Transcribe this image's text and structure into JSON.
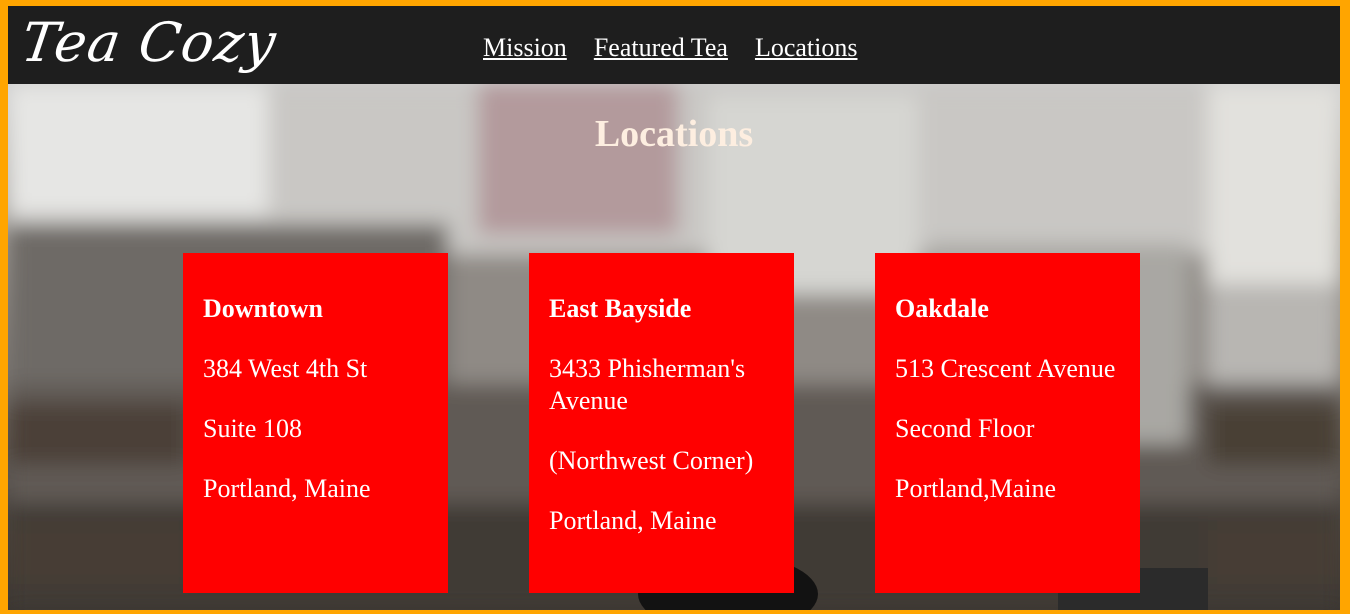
{
  "header": {
    "logo": "Tea Cozy",
    "nav": [
      "Mission",
      "Featured Tea",
      "Locations"
    ]
  },
  "locations": {
    "title": "Locations",
    "cards": [
      {
        "name": "Downtown",
        "lines": [
          "384 West 4th St",
          "Suite 108",
          "Portland, Maine"
        ]
      },
      {
        "name": "East Bayside",
        "lines": [
          "3433 Phisherman's Avenue",
          "(Northwest Corner)",
          "Portland, Maine"
        ]
      },
      {
        "name": "Oakdale",
        "lines": [
          "513 Crescent Avenue",
          "Second Floor",
          "Portland,Maine"
        ]
      }
    ]
  },
  "colors": {
    "page_border": "#ffa500",
    "header_bg": "#1e1e1e",
    "card_bg": "#ff0000",
    "title_text": "#fdeee0"
  }
}
